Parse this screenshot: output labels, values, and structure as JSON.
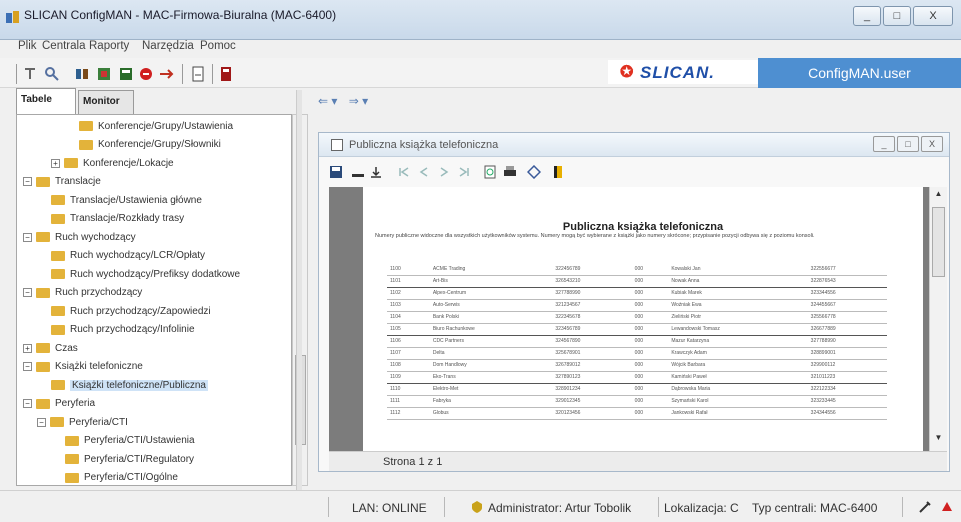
{
  "window": {
    "title": "SLICAN ConfigMAN - MAC-Firmowa-Biuralna (MAC-6400)",
    "buttons": {
      "minimize": "_",
      "maximize": "□",
      "close": "X"
    }
  },
  "menubar": [
    "Plik",
    "Centrala",
    "Raporty",
    "Narzędzia",
    "Pomoc"
  ],
  "toolbar": {
    "icons": [
      "reset-icon",
      "search-icon",
      "users-icon",
      "phones-icon",
      "grid-icon",
      "stop-icon",
      "arrows-icon",
      "page-icon",
      "book-icon"
    ]
  },
  "brand": {
    "logo_text": "SLICAN.",
    "product": "ConfigMAN.user"
  },
  "leftpanel": {
    "tabs": [
      "Tabele",
      "Monitor"
    ],
    "tree": [
      {
        "label": "Konferencje/Grupy/Ustawienia",
        "depth": 4,
        "type": "leaf"
      },
      {
        "label": "Konferencje/Grupy/Słowniki",
        "depth": 4,
        "type": "leaf"
      },
      {
        "label": "Konferencje/Lokacje",
        "depth": 2,
        "type": "expand",
        "exp": "+"
      },
      {
        "label": "Translacje",
        "depth": 0,
        "type": "expand",
        "exp": "−"
      },
      {
        "label": "Translacje/Ustawienia główne",
        "depth": 2,
        "type": "leaf"
      },
      {
        "label": "Translacje/Rozkłady trasy",
        "depth": 2,
        "type": "leaf"
      },
      {
        "label": "Ruch wychodzący",
        "depth": 0,
        "type": "expand",
        "exp": "−"
      },
      {
        "label": "Ruch wychodzący/LCR/Opłaty",
        "depth": 2,
        "type": "leaf"
      },
      {
        "label": "Ruch wychodzący/Prefiksy dodatkowe",
        "depth": 2,
        "type": "leaf"
      },
      {
        "label": "Ruch przychodzący",
        "depth": 0,
        "type": "expand",
        "exp": "−"
      },
      {
        "label": "Ruch przychodzący/Zapowiedzi",
        "depth": 2,
        "type": "leaf"
      },
      {
        "label": "Ruch przychodzący/Infolinie",
        "depth": 2,
        "type": "leaf"
      },
      {
        "label": "Czas",
        "depth": 0,
        "type": "expand",
        "exp": "+"
      },
      {
        "label": "Książki telefoniczne",
        "depth": 0,
        "type": "expand",
        "exp": "−"
      },
      {
        "label": "Książki telefoniczne/Publiczna",
        "depth": 2,
        "type": "leaf",
        "selected": true
      },
      {
        "label": "Peryferia",
        "depth": 0,
        "type": "expand",
        "exp": "−"
      },
      {
        "label": "Peryferia/CTI",
        "depth": 1,
        "type": "expand",
        "exp": "−"
      },
      {
        "label": "Peryferia/CTI/Ustawienia",
        "depth": 3,
        "type": "leaf"
      },
      {
        "label": "Peryferia/CTI/Regulatory",
        "depth": 3,
        "type": "leaf"
      },
      {
        "label": "Peryferia/CTI/Ogólne",
        "depth": 3,
        "type": "leaf"
      }
    ],
    "hscroll_label": "III"
  },
  "nav": {
    "back": "⇐ ▾",
    "forward": "⇒ ▾"
  },
  "document_window": {
    "title": "Publiczna książka telefoniczna",
    "buttons": {
      "minimize": "_",
      "maximize": "□",
      "close": "X"
    },
    "toolbar_icons": [
      "save-icon",
      "minus-icon",
      "export-icon",
      "first-page-icon",
      "prev-page-icon",
      "next-page-icon",
      "last-page-icon",
      "preview-icon",
      "print-icon",
      "find-icon",
      "exit-icon"
    ],
    "paper": {
      "title": "Publiczna książka telefoniczna",
      "note": "Numery publiczne widoczne dla wszystkich użytkowników systemu. Numery mogą być wybierane z książki jako numery skrócone; przypisanie pozycji odbywa się z poziomu konsoli.",
      "rows": [
        [
          "1100",
          "ACME Trading",
          "322456789",
          "000",
          "Kowalski Jan",
          "322556677"
        ],
        [
          "1101",
          "Art-Bis",
          "326543210",
          "000",
          "Nowak Anna",
          "322876543"
        ],
        [
          "1102",
          "Alpex-Centrum",
          "327788990",
          "000",
          "Kubiak Marek",
          "323344556"
        ],
        [
          "1103",
          "Auto-Serwis",
          "321234567",
          "000",
          "Woźniak Ewa",
          "324455667"
        ],
        [
          "1104",
          "Bank Polski",
          "322345678",
          "000",
          "Zieliński Piotr",
          "325566778"
        ],
        [
          "1105",
          "Biuro Rachunkowe",
          "323456789",
          "000",
          "Lewandowski Tomasz",
          "326677889"
        ],
        [
          "1106",
          "CDC Partners",
          "324567890",
          "000",
          "Mazur Katarzyna",
          "327788990"
        ],
        [
          "1107",
          "Delta",
          "325678901",
          "000",
          "Krawczyk Adam",
          "328899001"
        ],
        [
          "1108",
          "Dom Handlowy",
          "326789012",
          "000",
          "Wójcik Barbara",
          "329900112"
        ],
        [
          "1109",
          "Eko-Trans",
          "327890123",
          "000",
          "Kamiński Paweł",
          "321011223"
        ],
        [
          "1110",
          "Elektro-Met",
          "328901234",
          "000",
          "Dąbrowska Maria",
          "322122334"
        ],
        [
          "1111",
          "Fabryka",
          "329012345",
          "000",
          "Szymański Karol",
          "323233445"
        ],
        [
          "1112",
          "Globus",
          "320123456",
          "000",
          "Jankowski Rafał",
          "324344556"
        ]
      ]
    },
    "page_label": "Strona 1 z 1"
  },
  "statusbar": {
    "connection": "LAN: ONLINE",
    "user": "Administrator: Artur Tobolik",
    "location": "Lokalizacja: C",
    "device": "Typ centrali: MAC-6400"
  },
  "colors": {
    "brand_blue": "#4e8fd1",
    "brand_logo_blue": "#1f4fa8",
    "brand_red": "#e03020",
    "folder": "#e3b33a"
  }
}
